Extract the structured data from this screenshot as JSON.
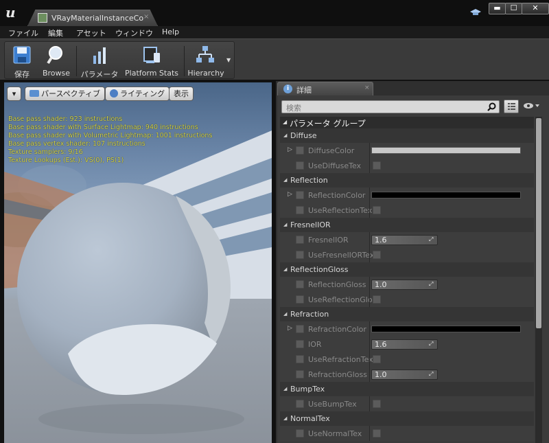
{
  "window": {
    "tab_title": "VRayMaterialInstanceCo",
    "tab_close": "×",
    "controls": {
      "minimize": "▬",
      "maximize": "☐",
      "close": "✕"
    }
  },
  "menu": {
    "items": [
      "ファイル",
      "編集",
      "アセット",
      "ウィンドウ",
      "Help"
    ]
  },
  "toolbar": {
    "save": "保存",
    "browse": "Browse",
    "params": "パラメータ",
    "platform_stats": "Platform Stats",
    "hierarchy": "Hierarchy"
  },
  "viewport": {
    "perspective": "パースペクティブ",
    "lighting": "ライティング",
    "show": "表示",
    "stats": [
      "Base pass shader: 923 instructions",
      "Base pass shader with Surface Lightmap: 940 instructions",
      "Base pass shader with Volumetric Lightmap: 1001 instructions",
      "Base pass vertex shader: 107 instructions",
      "Texture samplers: 9/16",
      "Texture Lookups (Est.): VS(0), PS(1)"
    ]
  },
  "details": {
    "tab_label": "詳細",
    "tab_close": "×",
    "search_placeholder": "検索",
    "category": "パラメータ グループ",
    "groups": [
      {
        "name": "Diffuse"
      },
      {
        "name": "Reflection"
      },
      {
        "name": "FresnelIOR"
      },
      {
        "name": "ReflectionGloss"
      },
      {
        "name": "Refraction"
      },
      {
        "name": "BumpTex"
      },
      {
        "name": "NormalTex"
      }
    ],
    "props": {
      "diffuse_color": {
        "name": "DiffuseColor",
        "color": "#c8c8c8"
      },
      "use_diffuse_tex": {
        "name": "UseDiffuseTex"
      },
      "reflection_color": {
        "name": "ReflectionColor",
        "color": "#000000"
      },
      "use_reflection_tex": {
        "name": "UseReflectionTex"
      },
      "fresnel_ior": {
        "name": "FresnelIOR",
        "value": "1.6"
      },
      "use_fresnel_ior_tex": {
        "name": "UseFresnelIORTex"
      },
      "reflection_gloss": {
        "name": "ReflectionGloss",
        "value": "1.0"
      },
      "use_reflection_gloss": {
        "name": "UseReflectionGlos"
      },
      "refraction_color": {
        "name": "RefractionColor",
        "color": "#000000"
      },
      "ior": {
        "name": "IOR",
        "value": "1.6"
      },
      "use_refraction_tex": {
        "name": "UseRefractionTex"
      },
      "refraction_gloss": {
        "name": "RefractionGloss",
        "value": "1.0"
      },
      "use_bump_tex": {
        "name": "UseBumpTex"
      },
      "use_normal_tex": {
        "name": "UseNormalTex"
      }
    }
  }
}
